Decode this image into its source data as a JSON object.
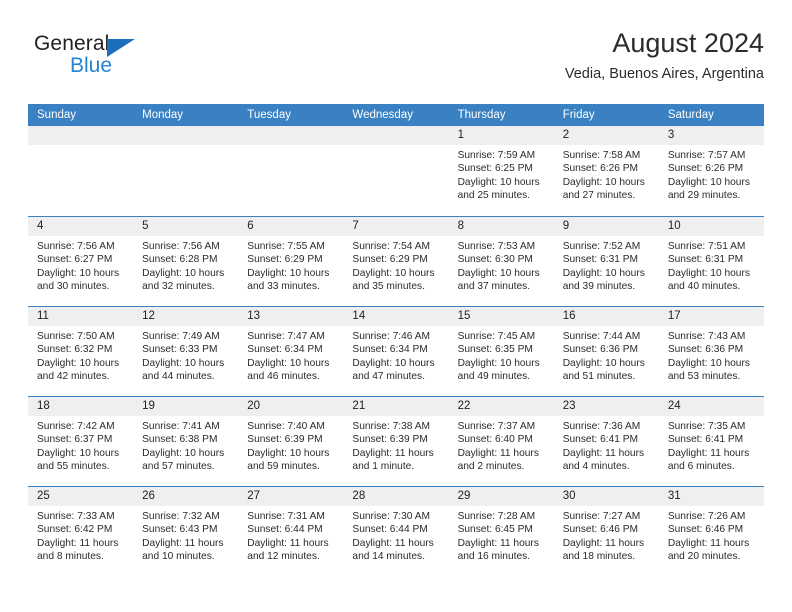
{
  "brand": {
    "name_top": "General",
    "name_bottom": "Blue",
    "triangle_color": "#1c6fba",
    "blue_text_color": "#2585d3"
  },
  "header": {
    "title": "August 2024",
    "subtitle": "Vedia, Buenos Aires, Argentina"
  },
  "theme": {
    "header_bar_color": "#3a81c3",
    "day_number_bar_color": "#efefef",
    "text_color": "#2b2b2b"
  },
  "weekdays": [
    "Sunday",
    "Monday",
    "Tuesday",
    "Wednesday",
    "Thursday",
    "Friday",
    "Saturday"
  ],
  "weeks": [
    [
      {
        "day": "",
        "empty": true
      },
      {
        "day": "",
        "empty": true
      },
      {
        "day": "",
        "empty": true
      },
      {
        "day": "",
        "empty": true
      },
      {
        "day": "1",
        "sunrise": "Sunrise: 7:59 AM",
        "sunset": "Sunset: 6:25 PM",
        "daylight_1": "Daylight: 10 hours",
        "daylight_2": "and 25 minutes."
      },
      {
        "day": "2",
        "sunrise": "Sunrise: 7:58 AM",
        "sunset": "Sunset: 6:26 PM",
        "daylight_1": "Daylight: 10 hours",
        "daylight_2": "and 27 minutes."
      },
      {
        "day": "3",
        "sunrise": "Sunrise: 7:57 AM",
        "sunset": "Sunset: 6:26 PM",
        "daylight_1": "Daylight: 10 hours",
        "daylight_2": "and 29 minutes."
      }
    ],
    [
      {
        "day": "4",
        "sunrise": "Sunrise: 7:56 AM",
        "sunset": "Sunset: 6:27 PM",
        "daylight_1": "Daylight: 10 hours",
        "daylight_2": "and 30 minutes."
      },
      {
        "day": "5",
        "sunrise": "Sunrise: 7:56 AM",
        "sunset": "Sunset: 6:28 PM",
        "daylight_1": "Daylight: 10 hours",
        "daylight_2": "and 32 minutes."
      },
      {
        "day": "6",
        "sunrise": "Sunrise: 7:55 AM",
        "sunset": "Sunset: 6:29 PM",
        "daylight_1": "Daylight: 10 hours",
        "daylight_2": "and 33 minutes."
      },
      {
        "day": "7",
        "sunrise": "Sunrise: 7:54 AM",
        "sunset": "Sunset: 6:29 PM",
        "daylight_1": "Daylight: 10 hours",
        "daylight_2": "and 35 minutes."
      },
      {
        "day": "8",
        "sunrise": "Sunrise: 7:53 AM",
        "sunset": "Sunset: 6:30 PM",
        "daylight_1": "Daylight: 10 hours",
        "daylight_2": "and 37 minutes."
      },
      {
        "day": "9",
        "sunrise": "Sunrise: 7:52 AM",
        "sunset": "Sunset: 6:31 PM",
        "daylight_1": "Daylight: 10 hours",
        "daylight_2": "and 39 minutes."
      },
      {
        "day": "10",
        "sunrise": "Sunrise: 7:51 AM",
        "sunset": "Sunset: 6:31 PM",
        "daylight_1": "Daylight: 10 hours",
        "daylight_2": "and 40 minutes."
      }
    ],
    [
      {
        "day": "11",
        "sunrise": "Sunrise: 7:50 AM",
        "sunset": "Sunset: 6:32 PM",
        "daylight_1": "Daylight: 10 hours",
        "daylight_2": "and 42 minutes."
      },
      {
        "day": "12",
        "sunrise": "Sunrise: 7:49 AM",
        "sunset": "Sunset: 6:33 PM",
        "daylight_1": "Daylight: 10 hours",
        "daylight_2": "and 44 minutes."
      },
      {
        "day": "13",
        "sunrise": "Sunrise: 7:47 AM",
        "sunset": "Sunset: 6:34 PM",
        "daylight_1": "Daylight: 10 hours",
        "daylight_2": "and 46 minutes."
      },
      {
        "day": "14",
        "sunrise": "Sunrise: 7:46 AM",
        "sunset": "Sunset: 6:34 PM",
        "daylight_1": "Daylight: 10 hours",
        "daylight_2": "and 47 minutes."
      },
      {
        "day": "15",
        "sunrise": "Sunrise: 7:45 AM",
        "sunset": "Sunset: 6:35 PM",
        "daylight_1": "Daylight: 10 hours",
        "daylight_2": "and 49 minutes."
      },
      {
        "day": "16",
        "sunrise": "Sunrise: 7:44 AM",
        "sunset": "Sunset: 6:36 PM",
        "daylight_1": "Daylight: 10 hours",
        "daylight_2": "and 51 minutes."
      },
      {
        "day": "17",
        "sunrise": "Sunrise: 7:43 AM",
        "sunset": "Sunset: 6:36 PM",
        "daylight_1": "Daylight: 10 hours",
        "daylight_2": "and 53 minutes."
      }
    ],
    [
      {
        "day": "18",
        "sunrise": "Sunrise: 7:42 AM",
        "sunset": "Sunset: 6:37 PM",
        "daylight_1": "Daylight: 10 hours",
        "daylight_2": "and 55 minutes."
      },
      {
        "day": "19",
        "sunrise": "Sunrise: 7:41 AM",
        "sunset": "Sunset: 6:38 PM",
        "daylight_1": "Daylight: 10 hours",
        "daylight_2": "and 57 minutes."
      },
      {
        "day": "20",
        "sunrise": "Sunrise: 7:40 AM",
        "sunset": "Sunset: 6:39 PM",
        "daylight_1": "Daylight: 10 hours",
        "daylight_2": "and 59 minutes."
      },
      {
        "day": "21",
        "sunrise": "Sunrise: 7:38 AM",
        "sunset": "Sunset: 6:39 PM",
        "daylight_1": "Daylight: 11 hours",
        "daylight_2": "and 1 minute."
      },
      {
        "day": "22",
        "sunrise": "Sunrise: 7:37 AM",
        "sunset": "Sunset: 6:40 PM",
        "daylight_1": "Daylight: 11 hours",
        "daylight_2": "and 2 minutes."
      },
      {
        "day": "23",
        "sunrise": "Sunrise: 7:36 AM",
        "sunset": "Sunset: 6:41 PM",
        "daylight_1": "Daylight: 11 hours",
        "daylight_2": "and 4 minutes."
      },
      {
        "day": "24",
        "sunrise": "Sunrise: 7:35 AM",
        "sunset": "Sunset: 6:41 PM",
        "daylight_1": "Daylight: 11 hours",
        "daylight_2": "and 6 minutes."
      }
    ],
    [
      {
        "day": "25",
        "sunrise": "Sunrise: 7:33 AM",
        "sunset": "Sunset: 6:42 PM",
        "daylight_1": "Daylight: 11 hours",
        "daylight_2": "and 8 minutes."
      },
      {
        "day": "26",
        "sunrise": "Sunrise: 7:32 AM",
        "sunset": "Sunset: 6:43 PM",
        "daylight_1": "Daylight: 11 hours",
        "daylight_2": "and 10 minutes."
      },
      {
        "day": "27",
        "sunrise": "Sunrise: 7:31 AM",
        "sunset": "Sunset: 6:44 PM",
        "daylight_1": "Daylight: 11 hours",
        "daylight_2": "and 12 minutes."
      },
      {
        "day": "28",
        "sunrise": "Sunrise: 7:30 AM",
        "sunset": "Sunset: 6:44 PM",
        "daylight_1": "Daylight: 11 hours",
        "daylight_2": "and 14 minutes."
      },
      {
        "day": "29",
        "sunrise": "Sunrise: 7:28 AM",
        "sunset": "Sunset: 6:45 PM",
        "daylight_1": "Daylight: 11 hours",
        "daylight_2": "and 16 minutes."
      },
      {
        "day": "30",
        "sunrise": "Sunrise: 7:27 AM",
        "sunset": "Sunset: 6:46 PM",
        "daylight_1": "Daylight: 11 hours",
        "daylight_2": "and 18 minutes."
      },
      {
        "day": "31",
        "sunrise": "Sunrise: 7:26 AM",
        "sunset": "Sunset: 6:46 PM",
        "daylight_1": "Daylight: 11 hours",
        "daylight_2": "and 20 minutes."
      }
    ]
  ]
}
